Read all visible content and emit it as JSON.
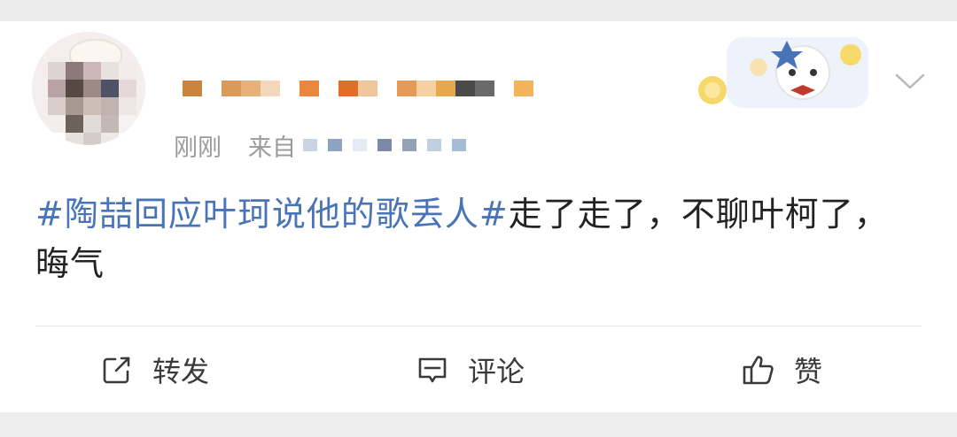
{
  "post": {
    "time": "刚刚",
    "from_label": "来自",
    "hashtag": "#陶喆回应叶珂说他的歌丢人#",
    "body": "走了走了，不聊叶柯了，晦气"
  },
  "actions": {
    "repost": "转发",
    "comment": "评论",
    "like": "赞"
  },
  "icons": {
    "repost": "share-box-icon",
    "comment": "comment-bubble-icon",
    "like": "thumbs-up-icon",
    "menu": "chevron-down-icon"
  },
  "colors": {
    "hashtag": "#4a74b8",
    "text": "#222222",
    "meta": "#9a9a9a"
  }
}
